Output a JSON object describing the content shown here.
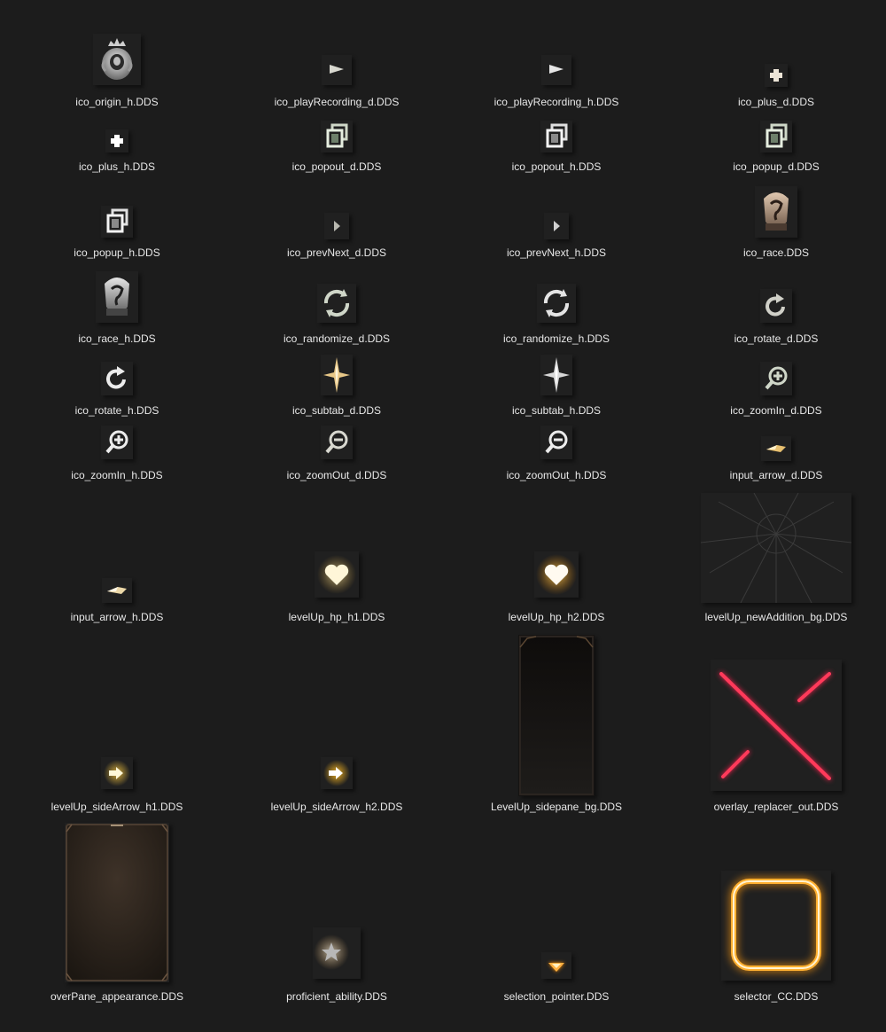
{
  "files": [
    {
      "label": "ico_origin_h.DDS",
      "icon": "origin-icon"
    },
    {
      "label": "ico_playRecording_d.DDS",
      "icon": "play-arrow-icon"
    },
    {
      "label": "ico_playRecording_h.DDS",
      "icon": "play-arrow-icon"
    },
    {
      "label": "ico_plus_d.DDS",
      "icon": "plus-icon"
    },
    {
      "label": "ico_plus_h.DDS",
      "icon": "plus-icon"
    },
    {
      "label": "ico_popout_d.DDS",
      "icon": "popout-icon"
    },
    {
      "label": "ico_popout_h.DDS",
      "icon": "popout-icon"
    },
    {
      "label": "ico_popup_d.DDS",
      "icon": "popup-icon"
    },
    {
      "label": "ico_popup_h.DDS",
      "icon": "popup-icon"
    },
    {
      "label": "ico_prevNext_d.DDS",
      "icon": "chevron-right-icon"
    },
    {
      "label": "ico_prevNext_h.DDS",
      "icon": "chevron-right-icon"
    },
    {
      "label": "ico_race.DDS",
      "icon": "race-mask-icon"
    },
    {
      "label": "ico_race_h.DDS",
      "icon": "race-mask-icon"
    },
    {
      "label": "ico_randomize_d.DDS",
      "icon": "randomize-icon"
    },
    {
      "label": "ico_randomize_h.DDS",
      "icon": "randomize-icon"
    },
    {
      "label": "ico_rotate_d.DDS",
      "icon": "rotate-icon"
    },
    {
      "label": "ico_rotate_h.DDS",
      "icon": "rotate-icon"
    },
    {
      "label": "ico_subtab_d.DDS",
      "icon": "star-sparkle-icon"
    },
    {
      "label": "ico_subtab_h.DDS",
      "icon": "star-sparkle-icon"
    },
    {
      "label": "ico_zoomIn_d.DDS",
      "icon": "zoom-in-icon"
    },
    {
      "label": "ico_zoomIn_h.DDS",
      "icon": "zoom-in-icon"
    },
    {
      "label": "ico_zoomOut_d.DDS",
      "icon": "zoom-out-icon"
    },
    {
      "label": "ico_zoomOut_h.DDS",
      "icon": "zoom-out-icon"
    },
    {
      "label": "input_arrow_d.DDS",
      "icon": "input-arrow-icon"
    },
    {
      "label": "input_arrow_h.DDS",
      "icon": "input-arrow-icon"
    },
    {
      "label": "levelUp_hp_h1.DDS",
      "icon": "heart-icon"
    },
    {
      "label": "levelUp_hp_h2.DDS",
      "icon": "heart-icon"
    },
    {
      "label": "levelUp_newAddition_bg.DDS",
      "icon": "radial-lines-image"
    },
    {
      "label": "levelUp_sideArrow_h1.DDS",
      "icon": "side-arrow-icon"
    },
    {
      "label": "levelUp_sideArrow_h2.DDS",
      "icon": "side-arrow-icon"
    },
    {
      "label": "LevelUp_sidepane_bg.DDS",
      "icon": "sidepane-background-image"
    },
    {
      "label": "overlay_replacer_out.DDS",
      "icon": "red-cross-lines-image"
    },
    {
      "label": "overPane_appearance.DDS",
      "icon": "pane-background-image"
    },
    {
      "label": "proficient_ability.DDS",
      "icon": "star-icon"
    },
    {
      "label": "selection_pointer.DDS",
      "icon": "triangle-down-icon"
    },
    {
      "label": "selector_CC.DDS",
      "icon": "rounded-square-glow-icon"
    }
  ]
}
